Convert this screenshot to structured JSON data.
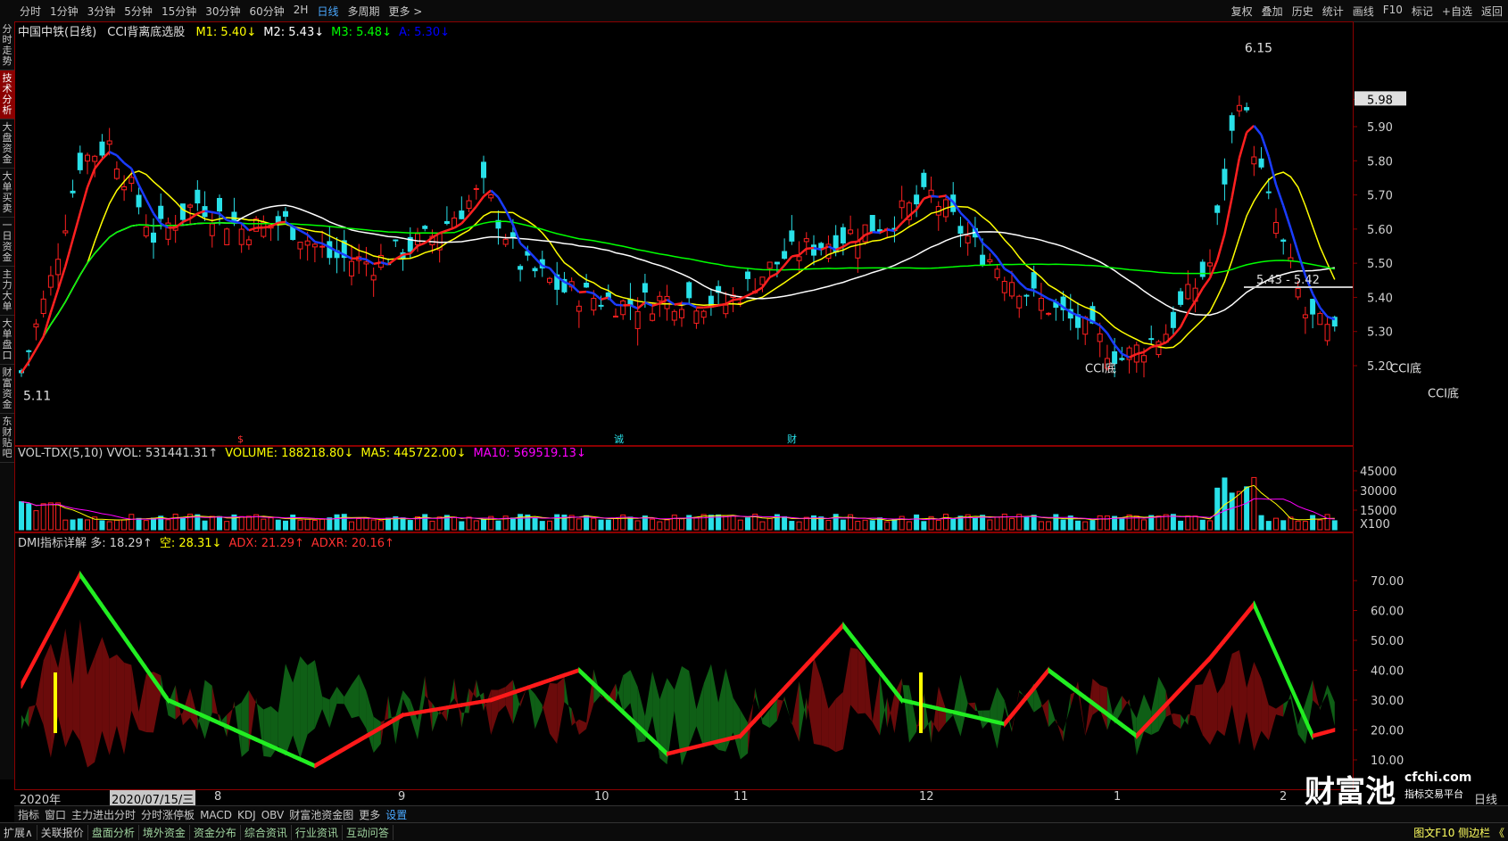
{
  "topbar": {
    "periods": [
      "分时",
      "1分钟",
      "3分钟",
      "5分钟",
      "15分钟",
      "30分钟",
      "60分钟",
      "2H",
      "日线",
      "多周期",
      "更多 >"
    ],
    "active_period": "日线",
    "tools": [
      "复权",
      "叠加",
      "历史",
      "统计",
      "画线",
      "F10",
      "标记",
      "+自选",
      "返回"
    ]
  },
  "side_tabs": [
    "分时走势",
    "技术分析",
    "大盘资金",
    "大单买卖",
    "一日资金",
    "主力大单",
    "大单盘口",
    "财富资金",
    "东财贴吧"
  ],
  "active_side_tab": "技术分析",
  "main_chart": {
    "title": "中国中铁(日线)",
    "indicator": "CCI背离底选股",
    "legend": [
      {
        "text": "M1: 5.40↓",
        "color": "#ffff00"
      },
      {
        "text": "M2: 5.43↓",
        "color": "#ffffff"
      },
      {
        "text": "M3: 5.48↓",
        "color": "#00ff00"
      },
      {
        "text": "A: 5.30↓",
        "color": "#0000ff"
      }
    ],
    "y_ticks": [
      "5.98",
      "5.90",
      "5.80",
      "5.70",
      "5.60",
      "5.50",
      "5.40",
      "5.30",
      "5.20"
    ],
    "annotations": {
      "high": "6.15",
      "low": "5.11",
      "right_price": "5.43 - 5.42",
      "cci_labels": [
        "CCI底",
        "CCI底",
        "CCI底"
      ],
      "cut_label": "CCI底",
      "event_markers": [
        "$",
        "诚",
        "财"
      ]
    }
  },
  "volume_chart": {
    "legend": [
      {
        "text": "VOL-TDX(5,10) VVOL: 531441.31↑",
        "color": "#d0d0d0"
      },
      {
        "text": "VOLUME: 188218.80↓",
        "color": "#ffff00"
      },
      {
        "text": "MA5: 445722.00↓",
        "color": "#ffff00"
      },
      {
        "text": "MA10: 569519.13↓",
        "color": "#ff00ff"
      }
    ],
    "y_ticks": [
      "45000",
      "30000",
      "15000"
    ],
    "unit": "X100"
  },
  "dmi_chart": {
    "legend": [
      {
        "text": "DMI指标详解 多: 18.29↑",
        "color": "#d0d0d0"
      },
      {
        "text": "空: 28.31↓",
        "color": "#ffff00"
      },
      {
        "text": "ADX: 21.29↑",
        "color": "#ff3030"
      },
      {
        "text": "ADXR: 20.16↑",
        "color": "#ff3030"
      }
    ],
    "y_ticks": [
      "70.00",
      "60.00",
      "50.00",
      "40.00",
      "30.00",
      "20.00",
      "10.00"
    ]
  },
  "x_axis": {
    "year": "2020年",
    "cursor_date": "2020/07/15/三",
    "months": [
      "8",
      "9",
      "10",
      "11",
      "12",
      "1",
      "2"
    ],
    "right_label": "日线"
  },
  "bottom_tabs_1": [
    "指标",
    "窗口",
    "主力进出分时",
    "分时涨停板",
    "MACD",
    "KDJ",
    "OBV",
    "财富池资金图",
    "更多",
    "设置"
  ],
  "bottom_tabs_2": [
    "扩展∧",
    "关联报价",
    "盘面分析",
    "境外资金",
    "资金分布",
    "综合资讯",
    "行业资讯",
    "互动问答"
  ],
  "bottom_right": "图文F10 侧边栏 《",
  "watermark": {
    "main": "财富池",
    "site": "cfchi.com",
    "sub": "指标交易平台"
  },
  "colors": {
    "up": "#ff2020",
    "down": "#28e0e8",
    "bg": "#000000",
    "grid": "#8b0000"
  }
}
